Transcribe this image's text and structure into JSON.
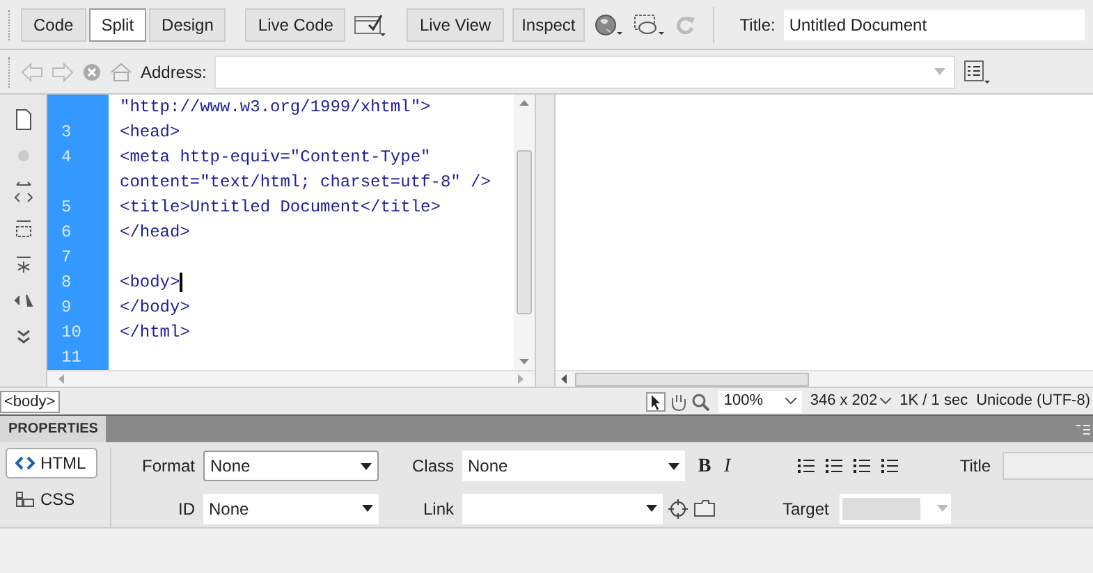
{
  "toolbar": {
    "view_buttons": [
      {
        "label": "Code",
        "selected": false
      },
      {
        "label": "Split",
        "selected": true
      },
      {
        "label": "Design",
        "selected": false
      }
    ],
    "live_code": "Live Code",
    "live_view": "Live View",
    "inspect": "Inspect",
    "title_label": "Title:",
    "title_value": "Untitled Document"
  },
  "address_bar": {
    "label": "Address:"
  },
  "editor": {
    "lines": [
      {
        "text": "\"http://www.w3.org/1999/xhtml\">"
      },
      {
        "number": "3",
        "text": "<head>"
      },
      {
        "number": "4",
        "text": "<meta http-equiv=\"Content-Type\""
      },
      {
        "text": "content=\"text/html; charset=utf-8\" />"
      },
      {
        "number": "5",
        "text": "<title>Untitled Document</title>"
      },
      {
        "number": "6",
        "text": "</head>"
      },
      {
        "number": "7"
      },
      {
        "number": "8",
        "text": "<body>",
        "cursor": true
      },
      {
        "number": "9",
        "text": "</body>"
      },
      {
        "number": "10",
        "text": "</html>"
      },
      {
        "number": "11"
      }
    ]
  },
  "status_bar": {
    "tag": "<body>",
    "zoom": "100%",
    "size": "346 x 202",
    "download": "1K / 1 sec",
    "encoding": "Unicode (UTF-8)"
  },
  "properties": {
    "title": "PROPERTIES",
    "modes": [
      {
        "label": "HTML",
        "selected": true
      },
      {
        "label": "CSS",
        "selected": false
      }
    ],
    "format_label": "Format",
    "format_value": "None",
    "id_label": "ID",
    "id_value": "None",
    "class_label": "Class",
    "class_value": "None",
    "link_label": "Link",
    "bold": "B",
    "italic": "I",
    "title_label": "Title",
    "target_label": "Target"
  }
}
